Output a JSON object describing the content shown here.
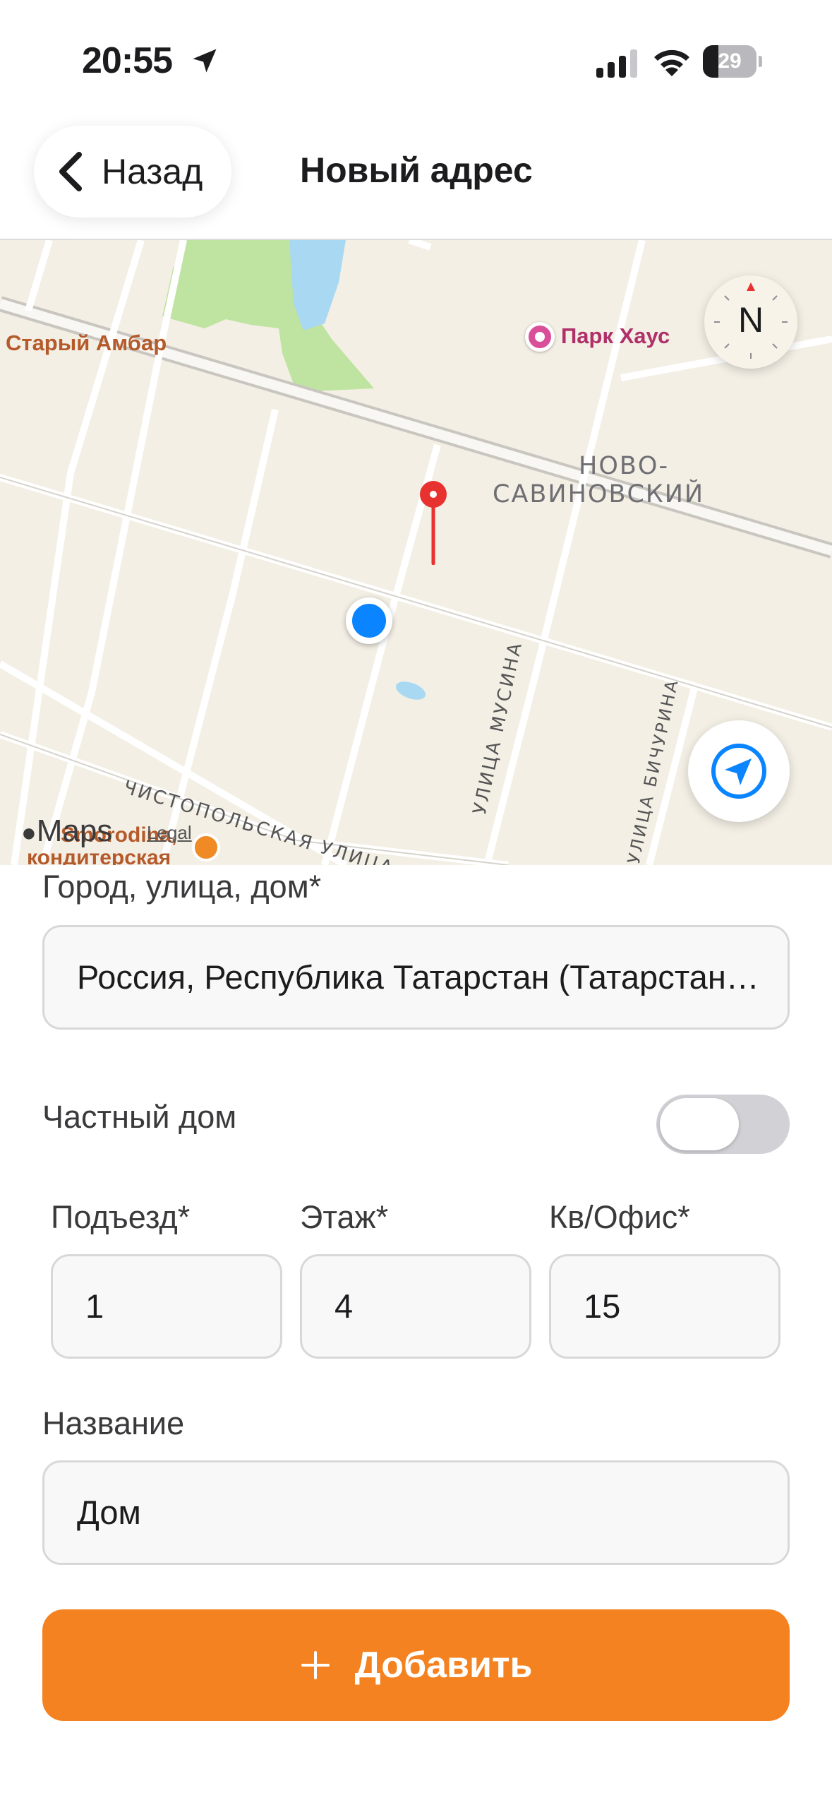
{
  "status_bar": {
    "time": "20:55",
    "battery_percent": "29",
    "battery_level": 0.29
  },
  "header": {
    "back_label": "Назад",
    "title": "Новый адрес"
  },
  "map": {
    "labels": {
      "place_left": "Старый Амбар",
      "place_poi": "Парк Хаус",
      "district_line1": "НОВО-",
      "district_line2": "САВИНОВСКИЙ",
      "street_chistopolskaya": "ЧИСТОПОЛЬСКАЯ УЛИЦА",
      "street_musina": "УЛИЦА МУСИНА",
      "street_bichurina": "УЛИЦА БИЧУРИНА",
      "shop_name": "Smorodina,",
      "shop_type": "кондитерская"
    },
    "attribution": "Maps",
    "legal": "Legal",
    "compass_letter": "N"
  },
  "form": {
    "address_label": "Город, улица, дом*",
    "address_value": "Россия, Республика Татарстан (Татарстан), Казань",
    "private_house_label": "Частный дом",
    "private_house_on": false,
    "entrance_label": "Подъезд*",
    "entrance_value": "1",
    "floor_label": "Этаж*",
    "floor_value": "4",
    "apartment_label": "Кв/Офис*",
    "apartment_value": "15",
    "name_label": "Название",
    "name_value": "Дом"
  },
  "actions": {
    "add_label": "Добавить"
  },
  "colors": {
    "accent": "#f58220",
    "user_location": "#0a84ff",
    "pin": "#e8322f"
  }
}
